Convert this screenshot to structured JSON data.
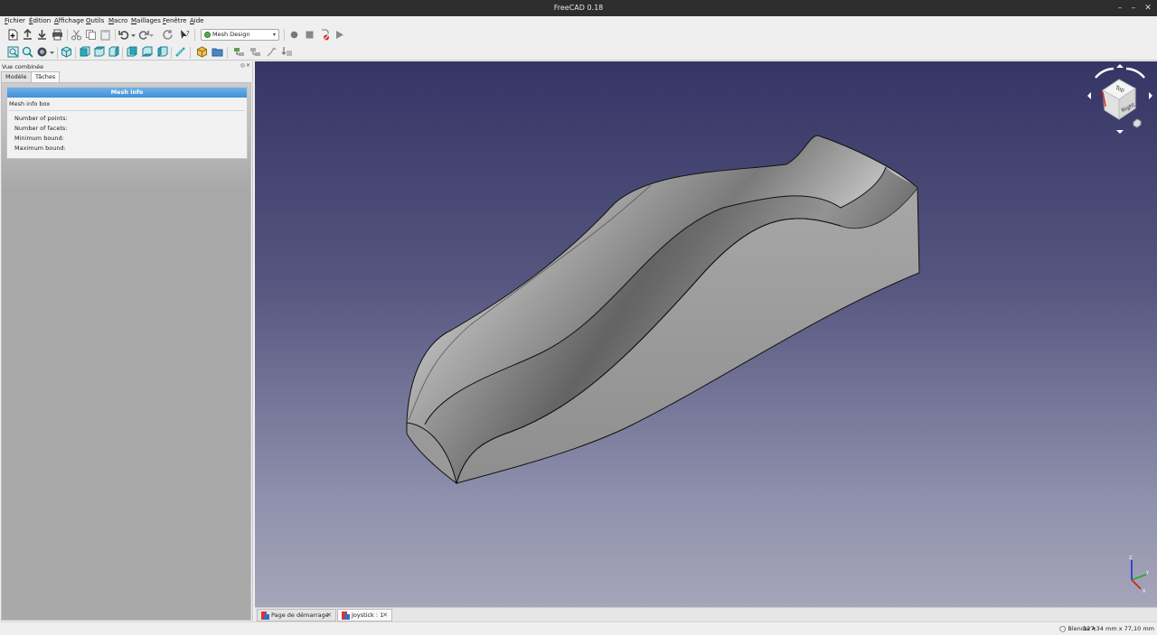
{
  "window": {
    "title": "FreeCAD 0.18",
    "minimize": "–",
    "maximize": "–",
    "close": "✕"
  },
  "menu": [
    "Fichier",
    "Édition",
    "Affichage",
    "Outils",
    "Macro",
    "Maillages",
    "Fenêtre",
    "Aide"
  ],
  "toolbar": {
    "workbench": "Mesh Design"
  },
  "combo": {
    "title": "Vue combinée",
    "float": "◎",
    "close": "✕",
    "tabs": [
      "Modèle",
      "Tâches"
    ],
    "mesh_info": {
      "header": "Mesh info",
      "box_title": "Mesh info box",
      "fields": [
        "Number of points:",
        "Number of facets:",
        "Minimum bound:",
        "Maximum bound:"
      ]
    }
  },
  "nav_cube": {
    "top_face": "Top",
    "front_face": "Right"
  },
  "axes": {
    "x": "X",
    "y": "Y",
    "z": "Z"
  },
  "doc_tabs": [
    {
      "label": "Page de démarrage",
      "close": "✕"
    },
    {
      "label": "Joystick : 1",
      "close": "✕"
    }
  ],
  "status": {
    "navigation": "Blender",
    "nav_caret": "▾",
    "dimensions": "127,34 mm x 77,10 mm"
  },
  "colors": {
    "accent": "#3f8fd8",
    "viewport_top": "#353566",
    "viewport_bottom": "#a5a6b9"
  }
}
